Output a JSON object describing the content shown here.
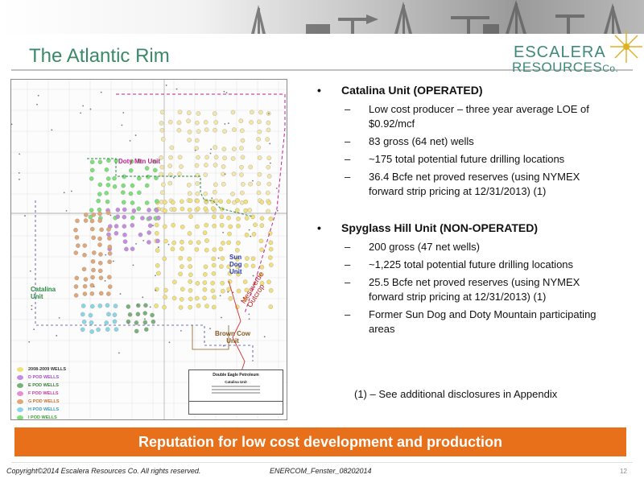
{
  "header": {
    "title": "The Atlantic Rim"
  },
  "logo": {
    "line1": "ESCALERA",
    "line2": "RESOURCES",
    "co": "Co."
  },
  "map": {
    "labels": {
      "doty": "Doty Mtn Unit",
      "sundog": "Sun Dog Unit",
      "catalina": "Catalina Unit",
      "browncow": "Brown Cow Unit",
      "mesaverde": "Mesaverde Outcrop"
    },
    "legend": [
      {
        "label": "2008-2009 WELLS",
        "color": "#f2e07a"
      },
      {
        "label": "D POD WELLS",
        "color": "#c58de0"
      },
      {
        "label": "E POD WELLS",
        "color": "#7ab07a"
      },
      {
        "label": "F POD WELLS",
        "color": "#e58fd0"
      },
      {
        "label": "G POD WELLS",
        "color": "#e0a878"
      },
      {
        "label": "H POD WELLS",
        "color": "#8ad6e8"
      },
      {
        "label": "I POD WELLS",
        "color": "#7de07a"
      }
    ],
    "titleblock": {
      "company": "Double Eagle Petroleum",
      "unit": "Catalina Unit"
    }
  },
  "sections": [
    {
      "heading": "Catalina Unit (OPERATED)",
      "items": [
        "Low cost producer – three year average LOE of $0.92/mcf",
        "83 gross (64 net) wells",
        "~175 total potential future drilling locations",
        " 36.4 Bcfe net proved reserves (using NYMEX forward strip pricing at 12/31/2013) (1)"
      ]
    },
    {
      "heading": "Spyglass Hill Unit (NON-OPERATED)",
      "items": [
        "200 gross (47 net wells)",
        "~1,225 total potential future drilling locations",
        "25.5 Bcfe net proved reserves (using NYMEX forward strip pricing at 12/31/2013) (1)",
        "Former Sun Dog and Doty Mountain participating areas"
      ]
    }
  ],
  "footnote": "(1) – See additional disclosures in Appendix",
  "banner": "Reputation for low cost development and production",
  "footer": {
    "copyright": "Copyright©2014 Escalera Resources Co. All rights reserved.",
    "doc_id": "ENERCOM_Fenster_08202014",
    "page": "12"
  },
  "colors": {
    "title": "#3a8a6a",
    "banner": "#e8701a"
  }
}
